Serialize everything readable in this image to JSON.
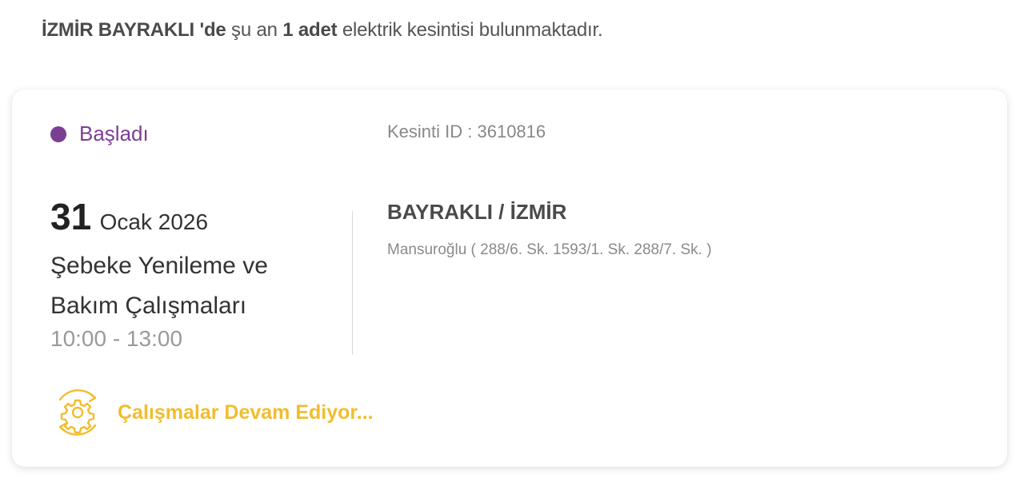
{
  "summary": {
    "location": "İZMİR BAYRAKLI 'de",
    "text_before_count": "şu an",
    "count": "1 adet",
    "text_after_count": "elektrik kesintisi bulunmaktadır."
  },
  "outage": {
    "status_label": "Başladı",
    "status_color": "#7b3f92",
    "id_text": "Kesinti ID : 3610816",
    "date_day": "31",
    "date_month_year": "Ocak 2026",
    "reason": "Şebeke Yenileme ve Bakım Çalışmaları",
    "time_range": "10:00 - 13:00",
    "location": "BAYRAKLI / İZMİR",
    "streets": "Mansuroğlu ( 288/6. Sk. 1593/1. Sk. 288/7. Sk. )",
    "progress_icon": "gear-sync-icon",
    "progress_label": "Çalışmalar Devam Ediyor...",
    "progress_color": "#f2bd2c"
  }
}
